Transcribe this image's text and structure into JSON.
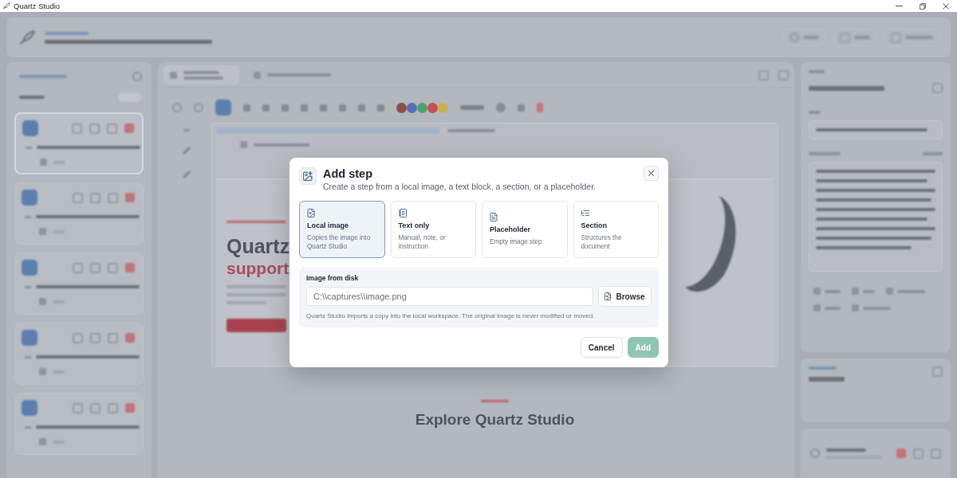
{
  "window": {
    "title": "Quartz Studio"
  },
  "background": {
    "toolbar_swatches": [
      {
        "color": "#8b5048"
      },
      {
        "color": "#5670b8"
      },
      {
        "color": "#4ea36b"
      },
      {
        "color": "#c4505a"
      },
      {
        "color": "#c8b24c"
      }
    ],
    "document": {
      "heading": "Quartz",
      "highlight": "support"
    },
    "section_heading": "Explore Quartz Studio"
  },
  "dialog": {
    "title": "Add step",
    "subtitle": "Create a step from a local image, a text block, a section, or a placeholder.",
    "options": [
      {
        "kind": "image",
        "title": "Local image",
        "description": "Copies the image into Quartz Studio",
        "selected": true
      },
      {
        "kind": "text",
        "title": "Text only",
        "description": "Manual, note, or instruction",
        "selected": false
      },
      {
        "kind": "placeholder",
        "title": "Placeholder",
        "description": "Empty image step",
        "selected": false
      },
      {
        "kind": "section",
        "title": "Section",
        "description": "Structures the document",
        "selected": false
      }
    ],
    "source": {
      "label": "Image from disk",
      "placeholder": "C:\\\\captures\\\\image.png",
      "browse": "Browse",
      "hint": "Quartz Studio imports a copy into the local workspace. The original image is never modified or moved."
    },
    "buttons": [
      {
        "kind": "secondary",
        "label": "Cancel",
        "disabled": false
      },
      {
        "kind": "primary",
        "label": "Add",
        "disabled": true
      }
    ]
  }
}
